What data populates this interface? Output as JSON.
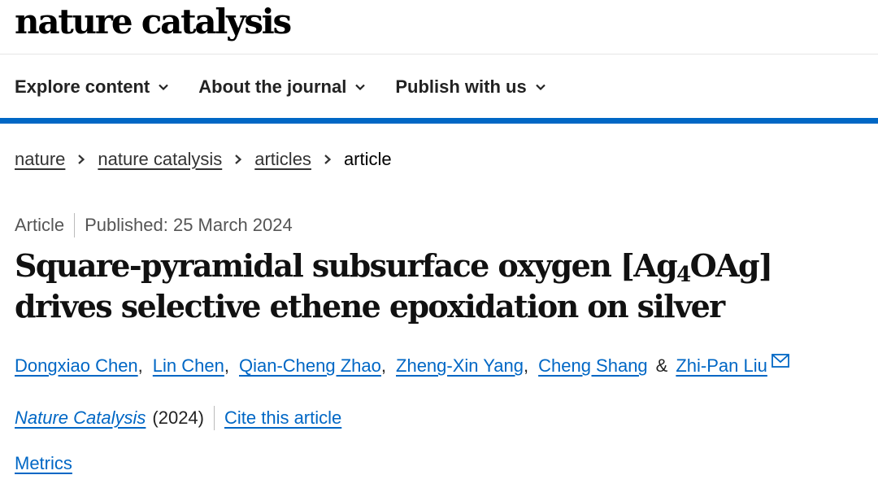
{
  "header": {
    "logo_text": "nature catalysis"
  },
  "nav": {
    "items": [
      {
        "label": "Explore content",
        "icon": "chevron-down-icon"
      },
      {
        "label": "About the journal",
        "icon": "chevron-down-icon"
      },
      {
        "label": "Publish with us",
        "icon": "chevron-down-icon"
      }
    ]
  },
  "colors": {
    "accent_bar": "#0067c5",
    "link": "#0067c5"
  },
  "breadcrumb": {
    "items": [
      "nature",
      "nature catalysis",
      "articles"
    ],
    "current": "article",
    "separator_icon": "chevron-right-icon"
  },
  "article": {
    "type": "Article",
    "published": "Published: 25 March 2024",
    "title": {
      "part1": "Square-pyramidal subsurface oxygen [Ag",
      "subscript": "4",
      "part2": "OAg] drives selective ethene epoxidation on silver"
    },
    "authors": [
      "Dongxiao Chen",
      "Lin Chen",
      "Qian-Cheng Zhao",
      "Zheng-Xin Yang",
      "Cheng Shang",
      "Zhi-Pan Liu"
    ],
    "author_separator": ",",
    "author_final_separator": "&",
    "corresponding_icon": "mail-icon",
    "journal": "Nature Catalysis",
    "year": "(2024)",
    "cite_label": "Cite this article",
    "metrics_label": "Metrics"
  }
}
